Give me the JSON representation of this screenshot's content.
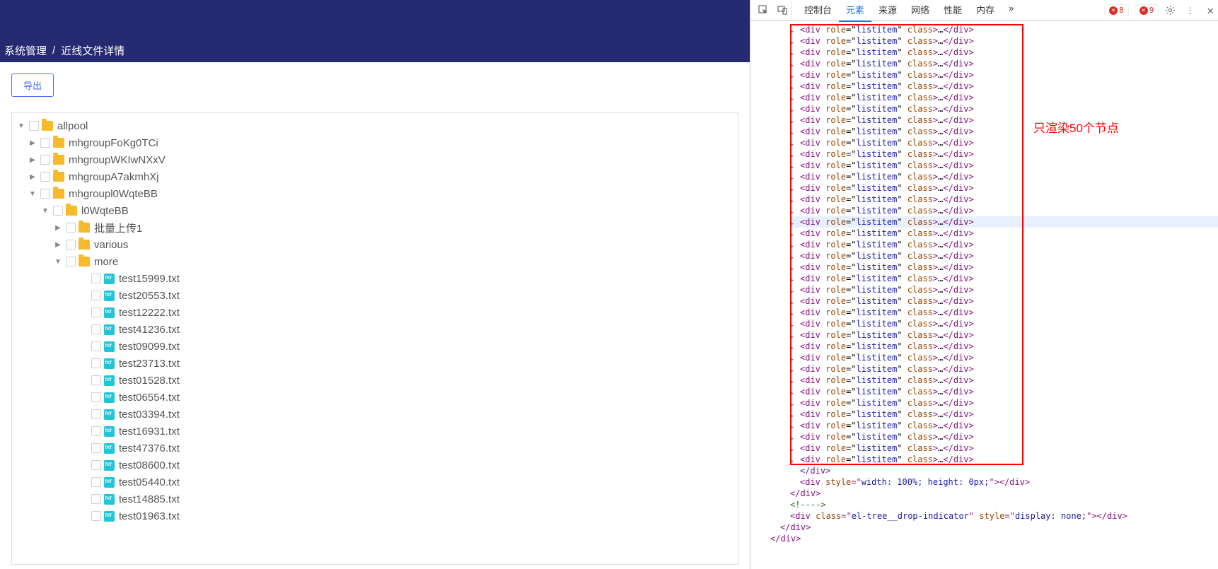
{
  "breadcrumb": {
    "root": "系统管理",
    "page": "近线文件详情"
  },
  "buttons": {
    "export": "导出"
  },
  "tree": {
    "root": "allpool",
    "folders_l1": [
      "mhgroupFoKg0TCi",
      "mhgroupWKIwNXxV",
      "mhgroupA7akmhXj",
      "mhgroupl0WqteBB"
    ],
    "folder_l2": "l0WqteBB",
    "folders_l3": [
      "批量上传1",
      "various",
      "more"
    ],
    "files": [
      "test15999.txt",
      "test20553.txt",
      "test12222.txt",
      "test41236.txt",
      "test09099.txt",
      "test23713.txt",
      "test01528.txt",
      "test06554.txt",
      "test03394.txt",
      "test16931.txt",
      "test47376.txt",
      "test08600.txt",
      "test05440.txt",
      "test14885.txt",
      "test01963.txt"
    ]
  },
  "devtools": {
    "tabs": [
      "控制台",
      "元素",
      "来源",
      "网络",
      "性能",
      "内存"
    ],
    "more": "»",
    "errors": "8",
    "warnings": "9",
    "listitem_count": 39,
    "highlight_index": 17,
    "annotation": "只渲染50个节点",
    "tail": {
      "close_div1": "</div>",
      "style_div": "<div style=\"width: 100%; height: 0px;\"></div>",
      "close_div2": "</div>",
      "comment": "<!---->",
      "drop": "<div class=\"el-tree__drop-indicator\" style=\"display: none;\"></div>",
      "close_div3": "</div>",
      "close_div4": "</div>"
    }
  }
}
